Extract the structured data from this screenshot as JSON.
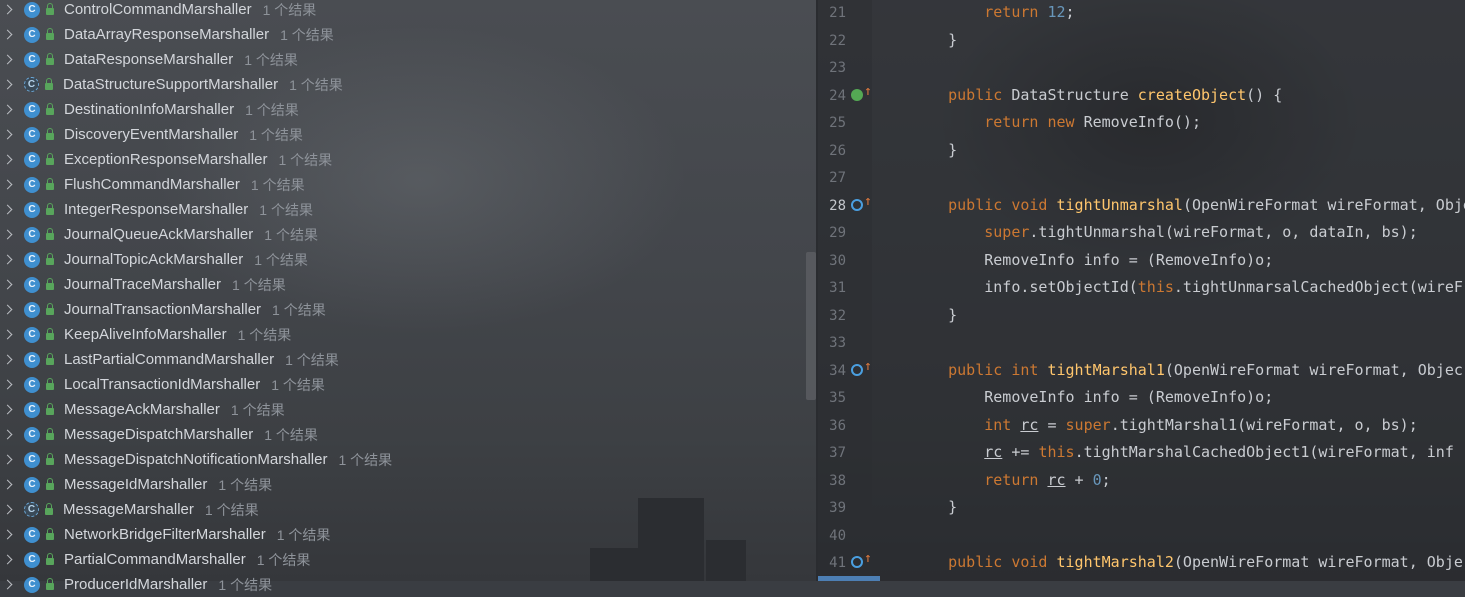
{
  "tree": {
    "count_label": "1 个结果",
    "items": [
      {
        "name": "ControlCommandMarshaller",
        "icon": "c-class-icon"
      },
      {
        "name": "DataArrayResponseMarshaller",
        "icon": "c-class-icon"
      },
      {
        "name": "DataResponseMarshaller",
        "icon": "c-class-icon"
      },
      {
        "name": "DataStructureSupportMarshaller",
        "icon": "abstract-class-icon"
      },
      {
        "name": "DestinationInfoMarshaller",
        "icon": "c-class-icon"
      },
      {
        "name": "DiscoveryEventMarshaller",
        "icon": "c-class-icon"
      },
      {
        "name": "ExceptionResponseMarshaller",
        "icon": "c-class-icon"
      },
      {
        "name": "FlushCommandMarshaller",
        "icon": "c-class-icon"
      },
      {
        "name": "IntegerResponseMarshaller",
        "icon": "c-class-icon"
      },
      {
        "name": "JournalQueueAckMarshaller",
        "icon": "c-class-icon"
      },
      {
        "name": "JournalTopicAckMarshaller",
        "icon": "c-class-icon"
      },
      {
        "name": "JournalTraceMarshaller",
        "icon": "c-class-icon"
      },
      {
        "name": "JournalTransactionMarshaller",
        "icon": "c-class-icon"
      },
      {
        "name": "KeepAliveInfoMarshaller",
        "icon": "c-class-icon"
      },
      {
        "name": "LastPartialCommandMarshaller",
        "icon": "c-class-icon"
      },
      {
        "name": "LocalTransactionIdMarshaller",
        "icon": "c-class-icon"
      },
      {
        "name": "MessageAckMarshaller",
        "icon": "c-class-icon"
      },
      {
        "name": "MessageDispatchMarshaller",
        "icon": "c-class-icon"
      },
      {
        "name": "MessageDispatchNotificationMarshaller",
        "icon": "c-class-icon"
      },
      {
        "name": "MessageIdMarshaller",
        "icon": "c-class-icon"
      },
      {
        "name": "MessageMarshaller",
        "icon": "abstract-class-icon"
      },
      {
        "name": "NetworkBridgeFilterMarshaller",
        "icon": "c-class-icon"
      },
      {
        "name": "PartialCommandMarshaller",
        "icon": "c-class-icon"
      },
      {
        "name": "ProducerIdMarshaller",
        "icon": "c-class-icon"
      }
    ]
  },
  "editor": {
    "active_line": "28",
    "lines": [
      {
        "n": "21",
        "tokens": [
          [
            "",
            "        "
          ],
          [
            "kw",
            "return"
          ],
          [
            "",
            " "
          ],
          [
            "num",
            "12"
          ],
          [
            "",
            ";"
          ]
        ]
      },
      {
        "n": "22",
        "tokens": [
          [
            "",
            "    }"
          ]
        ]
      },
      {
        "n": "23",
        "tokens": []
      },
      {
        "n": "24",
        "gutter": "implements-icon",
        "tokens": [
          [
            "",
            "    "
          ],
          [
            "kw",
            "public"
          ],
          [
            "",
            " DataStructure "
          ],
          [
            "fn",
            "createObject"
          ],
          [
            "",
            "() {"
          ]
        ]
      },
      {
        "n": "25",
        "tokens": [
          [
            "",
            "        "
          ],
          [
            "kw",
            "return new"
          ],
          [
            "",
            " RemoveInfo();"
          ]
        ]
      },
      {
        "n": "26",
        "tokens": [
          [
            "",
            "    }"
          ]
        ]
      },
      {
        "n": "27",
        "tokens": []
      },
      {
        "n": "28",
        "gutter": "overrides-icon",
        "tokens": [
          [
            "",
            "    "
          ],
          [
            "kw",
            "public void"
          ],
          [
            "",
            " "
          ],
          [
            "fn",
            "tightUnmarshal"
          ],
          [
            "",
            "(OpenWireFormat wireFormat, Obje"
          ]
        ]
      },
      {
        "n": "29",
        "tokens": [
          [
            "",
            "        "
          ],
          [
            "kw",
            "super"
          ],
          [
            "",
            ".tightUnmarshal(wireFormat, o, dataIn, bs);"
          ]
        ]
      },
      {
        "n": "30",
        "tokens": [
          [
            "",
            "        RemoveInfo info = (RemoveInfo)o;"
          ]
        ]
      },
      {
        "n": "31",
        "tokens": [
          [
            "",
            "        info.setObjectId("
          ],
          [
            "kw",
            "this"
          ],
          [
            "",
            ".tightUnmarsalCachedObject(wireF"
          ]
        ]
      },
      {
        "n": "32",
        "tokens": [
          [
            "",
            "    }"
          ]
        ]
      },
      {
        "n": "33",
        "tokens": []
      },
      {
        "n": "34",
        "gutter": "overrides-icon",
        "tokens": [
          [
            "",
            "    "
          ],
          [
            "kw",
            "public int"
          ],
          [
            "",
            " "
          ],
          [
            "fn",
            "tightMarshal1"
          ],
          [
            "",
            "(OpenWireFormat wireFormat, Objec"
          ]
        ]
      },
      {
        "n": "35",
        "tokens": [
          [
            "",
            "        RemoveInfo info = (RemoveInfo)o;"
          ]
        ]
      },
      {
        "n": "36",
        "tokens": [
          [
            "",
            "        "
          ],
          [
            "kw",
            "int"
          ],
          [
            "",
            " "
          ],
          [
            "ul",
            "rc"
          ],
          [
            "",
            " = "
          ],
          [
            "kw",
            "super"
          ],
          [
            "",
            ".tightMarshal1(wireFormat, o, bs);"
          ]
        ]
      },
      {
        "n": "37",
        "tokens": [
          [
            "",
            "        "
          ],
          [
            "ul",
            "rc"
          ],
          [
            "",
            " += "
          ],
          [
            "kw",
            "this"
          ],
          [
            "",
            ".tightMarshalCachedObject1(wireFormat, inf"
          ]
        ]
      },
      {
        "n": "38",
        "tokens": [
          [
            "",
            "        "
          ],
          [
            "kw",
            "return"
          ],
          [
            "",
            " "
          ],
          [
            "ul",
            "rc"
          ],
          [
            "",
            " + "
          ],
          [
            "num",
            "0"
          ],
          [
            "",
            ";"
          ]
        ]
      },
      {
        "n": "39",
        "tokens": [
          [
            "",
            "    }"
          ]
        ]
      },
      {
        "n": "40",
        "tokens": []
      },
      {
        "n": "41",
        "gutter": "overrides-icon",
        "tokens": [
          [
            "",
            "    "
          ],
          [
            "kw",
            "public void"
          ],
          [
            "",
            " "
          ],
          [
            "fn",
            "tightMarshal2"
          ],
          [
            "",
            "(OpenWireFormat wireFormat, Obje"
          ]
        ]
      }
    ]
  }
}
